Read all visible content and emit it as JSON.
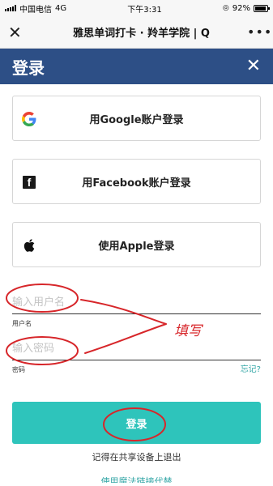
{
  "status_bar": {
    "carrier": "中国电信",
    "network": "4G",
    "time": "下午3:31",
    "battery": "92%",
    "battery_level": 0.92
  },
  "title_bar": {
    "title": "雅思单词打卡 · 羚羊学院 | Q",
    "close_icon": "close-icon",
    "more_icon": "more-icon"
  },
  "login": {
    "header_title": "登录",
    "google_label": "用Google账户登录",
    "facebook_label": "用Facebook账户登录",
    "apple_label": "使用Apple登录",
    "username_placeholder": "输入用户名",
    "username_caption": "用户名",
    "password_placeholder": "输入密码",
    "password_caption": "密码",
    "forgot_link": "忘记?",
    "submit_label": "登录",
    "remember_text": "记得在共享设备上退出",
    "bottom_link": "使用魔法链接代替"
  },
  "annotation": {
    "handwriting": "填写",
    "color": "#d7262a"
  },
  "colors": {
    "header": "#2d4f86",
    "button": "#2ec4bb",
    "link": "#33a6a6"
  }
}
